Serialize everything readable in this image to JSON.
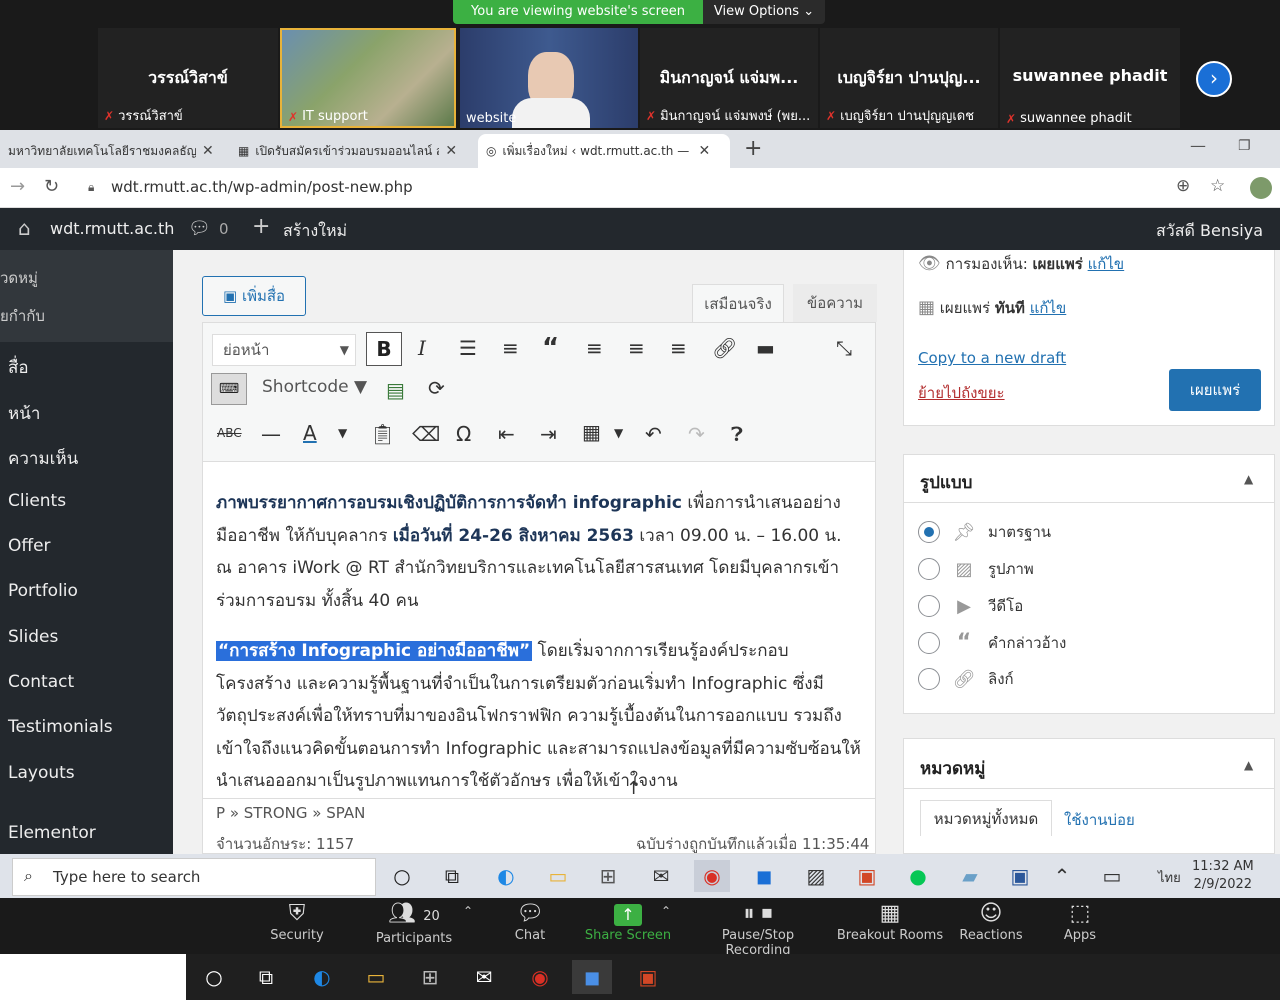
{
  "zoom": {
    "viewing_banner": "You are viewing website's screen",
    "view_options": "View Options",
    "participants": [
      {
        "big": "วรรณ์วิสาข์",
        "small": "วรรณ์วิสาข์"
      },
      {
        "big": "",
        "small": "IT support"
      },
      {
        "big": "",
        "small": "website"
      },
      {
        "big": "มินกาญจน์ แจ่มพ...",
        "small": "มินกาญจน์ แจ่มพงษ์ (พย..."
      },
      {
        "big": "เบญจิร์ยา ปานปุญ...",
        "small": "เบญจิร์ยา ปานปุญญเดช"
      },
      {
        "big": "suwannee phadit",
        "small": "suwannee phadit"
      }
    ],
    "controls": {
      "security": "Security",
      "participants": "Participants",
      "participants_count": "20",
      "chat": "Chat",
      "share": "Share Screen",
      "record": "Pause/Stop Recording",
      "breakout": "Breakout Rooms",
      "reactions": "Reactions",
      "apps": "Apps"
    }
  },
  "browser": {
    "tabs": [
      {
        "title": "มหาวิทยาลัยเทคโนโลยีราชมงคลธัญบุรี"
      },
      {
        "title": "เปิดรับสมัครเข้าร่วมอบรมออนไลน์ สำหรั"
      },
      {
        "title": "เพิ่มเรื่องใหม่ ‹ wdt.rmutt.ac.th — W"
      }
    ],
    "url": "wdt.rmutt.ac.th/wp-admin/post-new.php"
  },
  "wp": {
    "adminbar": {
      "site": "wdt.rmutt.ac.th",
      "comments": "0",
      "new": "สร้างใหม่",
      "greeting": "สวัสดี Bensiya"
    },
    "sidebar": {
      "sub": [
        "วดหมู่",
        "ยกำกับ"
      ],
      "items": [
        "สื่อ",
        "หน้า",
        "ความเห็น",
        "Clients",
        "Offer",
        "Portfolio",
        "Slides",
        "Contact",
        "Testimonials",
        "Layouts",
        "Elementor"
      ]
    },
    "editor": {
      "add_media": "เพิ่มสื่อ",
      "tab_visual": "เสมือนจริง",
      "tab_text": "ข้อความ",
      "format_select": "ย่อหน้า",
      "shortcode": "Shortcode",
      "para1": {
        "b1": "ภาพบรรยากาศการอบรมเชิงปฏิบัติการการจัดทำ infographic",
        "t1": " เพื่อการนำเสนออย่างมืออาชีพ ให้กับบุคลากร ",
        "b2": "เมื่อวันที่ 24-26 สิงหาคม 2563",
        "t2": " เวลา 09.00 น. – 16.00 น. ณ อาคาร iWork @ RT สำนักวิทยบริการและเทคโนโลยีสารสนเทศ โดยมีบุคลากรเข้าร่วมการอบรม ทั้งสิ้น 40 คน"
      },
      "para2": {
        "hl": "“การสร้าง Infographic อย่างมืออาชีพ”",
        "t": " โดยเริ่มจากการเรียนรู้องค์ประกอบโครงสร้าง และความรู้พื้นฐานที่จำเป็นในการเตรียมตัวก่อนเริ่มทำ Infographic ซึ่งมีวัตถุประสงค์เพื่อให้ทราบที่มาของอินโฟกราฟฟิก ความรู้เบื้องต้นในการออกแบบ รวมถึงเข้าใจถึงแนวคิดขั้นตอนการทำ Infographic และสามารถแปลงข้อมูลที่มีความซับซ้อนให้นำเสนอออกมาเป็นรูปภาพแทนการใช้ตัวอักษร เพื่อให้เข้าใจงาน"
      },
      "path": "P » STRONG » SPAN",
      "wordcount": "จำนวนอักษระ: 1157",
      "saved": "ฉบับร่างถูกบันทึกแล้วเมื่อ 11:35:44"
    },
    "publish": {
      "visibility_label": "การมองเห็น: ",
      "visibility_value": "เผยแพร่",
      "edit": "แก้ไข",
      "publish_label": "เผยแพร่ ",
      "publish_value": "ทันที",
      "copy_draft": "Copy to a new draft",
      "trash": "ย้ายไปถังขยะ",
      "button": "เผยแพร่"
    },
    "format": {
      "title": "รูปแบบ",
      "options": [
        "มาตรฐาน",
        "รูปภาพ",
        "วีดีโอ",
        "คำกล่าวอ้าง",
        "ลิงก์"
      ],
      "selected": "มาตรฐาน"
    },
    "category": {
      "title": "หมวดหมู่",
      "tab_all": "หมวดหมู่ทั้งหมด",
      "tab_used": "ใช้งานบ่อย"
    }
  },
  "windows": {
    "search_placeholder": "Type here to search",
    "lang": "ไทย",
    "time": "11:32 AM",
    "date": "2/9/2022"
  },
  "colors": {
    "zoom_green": "#3cb043",
    "wp_dark": "#23282d",
    "wp_blue": "#2271b1",
    "trash_red": "#b32d2e"
  }
}
